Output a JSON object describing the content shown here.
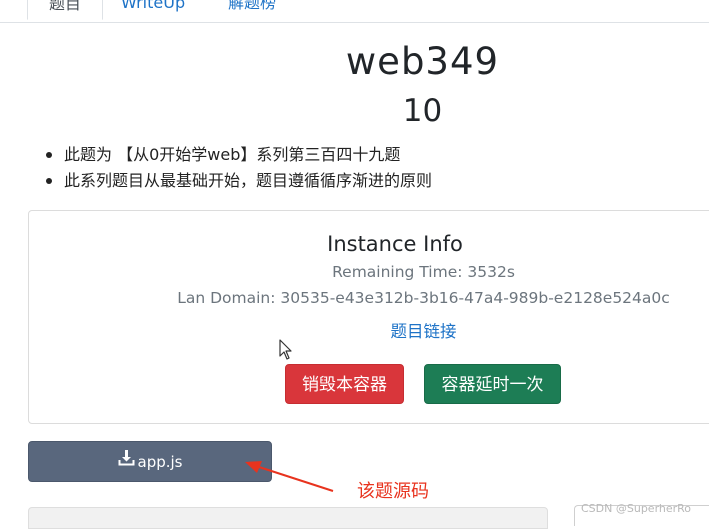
{
  "tabs": [
    {
      "label": "题目",
      "active": true
    },
    {
      "label": "WriteUp",
      "active": false
    },
    {
      "label": "解题榜",
      "active": false
    }
  ],
  "challenge": {
    "title": "web349",
    "score": "10",
    "description": [
      "此题为 【从0开始学web】系列第三百四十九题",
      "此系列题目从最基础开始，题目遵循循序渐进的原则"
    ]
  },
  "instance": {
    "title": "Instance Info",
    "remaining": "Remaining Time: 3532s",
    "domain": "Lan Domain: 30535-e43e312b-3b16-47a4-989b-e2128e524a0c",
    "link_label": "题目链接",
    "destroy_label": "销毁本容器",
    "extend_label": "容器延时一次"
  },
  "attachment": {
    "label": "app.js",
    "icon": "download-icon"
  },
  "annotation": {
    "text": "该题源码",
    "color": "#e8331e"
  },
  "watermark": "CSDN @SuperherRo",
  "colors": {
    "link": "#1e73c7",
    "danger": "#d9363b",
    "success": "#1d7d55",
    "download": "#59677d"
  }
}
